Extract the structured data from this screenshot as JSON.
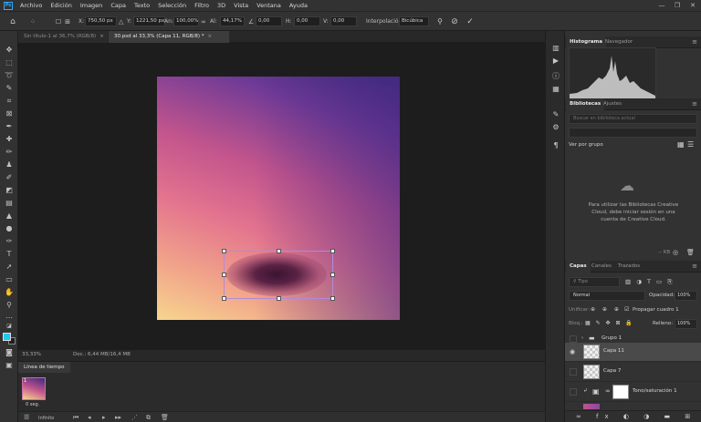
{
  "menubar": {
    "app_icon": "Ps",
    "items": [
      "Archivo",
      "Edición",
      "Imagen",
      "Capa",
      "Texto",
      "Selección",
      "Filtro",
      "3D",
      "Vista",
      "Ventana",
      "Ayuda"
    ],
    "window_controls": [
      "—",
      "❐",
      "✕"
    ]
  },
  "options_bar": {
    "x_label": "X:",
    "x_value": "750,50 px",
    "y_label": "Y:",
    "y_value": "1221,50 px",
    "w_label": "An:",
    "w_value": "100,00%",
    "h_label": "Al:",
    "h_value": "44,17%",
    "angle_value": "0,00",
    "hskew_label": "H:",
    "hskew_value": "0,00",
    "vskew_label": "V:",
    "vskew_value": "0,00",
    "interp_label": "Interpolación:",
    "interp_value": "Bicúbica"
  },
  "doc_tabs": [
    {
      "label": "Sin título-1 al 36,7% (RGB/8)",
      "close": "×",
      "active": false
    },
    {
      "label": "30.psd al 33,3% (Capa 11, RGB/8) *",
      "close": "×",
      "active": true
    }
  ],
  "status": {
    "zoom": "33,33%",
    "doc": "Doc.: 6,44 MB/16,4 MB"
  },
  "timeline": {
    "tab": "Línea de tiempo",
    "frame_number": "1",
    "frame_duration": "0 seg.",
    "loop": "Infinito"
  },
  "panels": {
    "histogram_tabs": [
      "Histograma",
      "Navegador"
    ],
    "libraries_tabs": [
      "Bibliotecas",
      "Ajustes"
    ],
    "libraries_search_placeholder": "Buscar en biblioteca actual",
    "view_by": "Ver por grupo",
    "libraries_message": "Para utilizar las Bibliotecas Creative Cloud, debe iniciar sesión en una cuenta de Creative Cloud.",
    "libraries_size": "-- KB",
    "layers_tabs": [
      "Capas",
      "Canales",
      "Trazados"
    ],
    "filter_label": "Tipo",
    "blend_mode": "Normal",
    "opacity_label": "Opacidad:",
    "opacity_value": "100%",
    "lock_label": "Unificar:",
    "propagate_label": "Propagar cuadro 1",
    "lock_label2": "Bloq.:",
    "fill_label": "Relleno:",
    "fill_value": "100%",
    "layers": [
      {
        "name": "Grupo 1",
        "type": "group"
      },
      {
        "name": "Capa 11",
        "type": "layer",
        "selected": true
      },
      {
        "name": "Capa 7",
        "type": "layer"
      },
      {
        "name": "Tono/saturación 1",
        "type": "adjustment"
      }
    ]
  },
  "colors": {
    "foreground": "#1ec9f0",
    "background": "#1f1f1f",
    "accent": "#31a8ff"
  }
}
